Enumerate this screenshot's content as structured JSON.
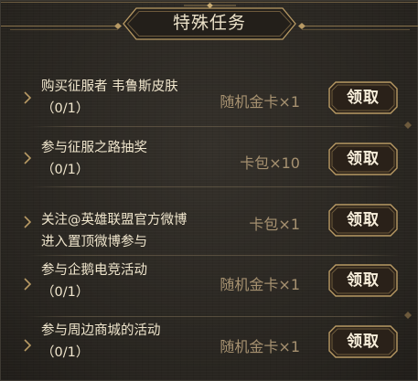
{
  "panel": {
    "title": "特殊任务"
  },
  "tasks": [
    {
      "name": "购买征服者 韦鲁斯皮肤",
      "progress": "（0/1）",
      "reward": "随机金卡×1",
      "button": "领取"
    },
    {
      "name": "参与征服之路抽奖",
      "progress": "（0/1）",
      "reward": "卡包×10",
      "button": "领取"
    },
    {
      "name": "关注@英雄联盟官方微博",
      "name_line2": "进入置顶微博参与",
      "reward": "卡包×1",
      "button": "领取"
    },
    {
      "name": "参与企鹅电竞活动",
      "progress": "（0/1）",
      "reward": "随机金卡×1",
      "button": "领取"
    },
    {
      "name": "参与周边商城的活动",
      "progress": "（0/1）",
      "reward": "随机金卡×1",
      "button": "领取"
    }
  ],
  "colors": {
    "background": "#2c2924",
    "gold": "#b89a64",
    "text": "#f0e6cd",
    "reward_text": "#a69170",
    "button_fill": "#2a2119"
  },
  "icons": {
    "bullet": "chevron-right-icon"
  }
}
